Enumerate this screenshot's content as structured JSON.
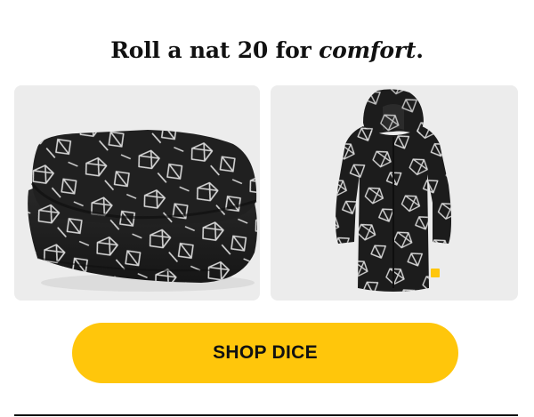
{
  "headline": {
    "prefix": "Roll a nat 20 for ",
    "emphasis": "comfort",
    "suffix": "."
  },
  "products": [
    {
      "name": "Dice print blanket",
      "image_icon": "folded-blanket-image"
    },
    {
      "name": "Dice print hooded robe",
      "image_icon": "hooded-robe-image"
    }
  ],
  "cta": {
    "label": "SHOP DICE"
  },
  "colors": {
    "accent": "#FFC60B",
    "card_bg": "#ECECEC",
    "product_fabric": "#1C1C1C",
    "pattern_line": "#E8E8E8",
    "text": "#111111"
  }
}
